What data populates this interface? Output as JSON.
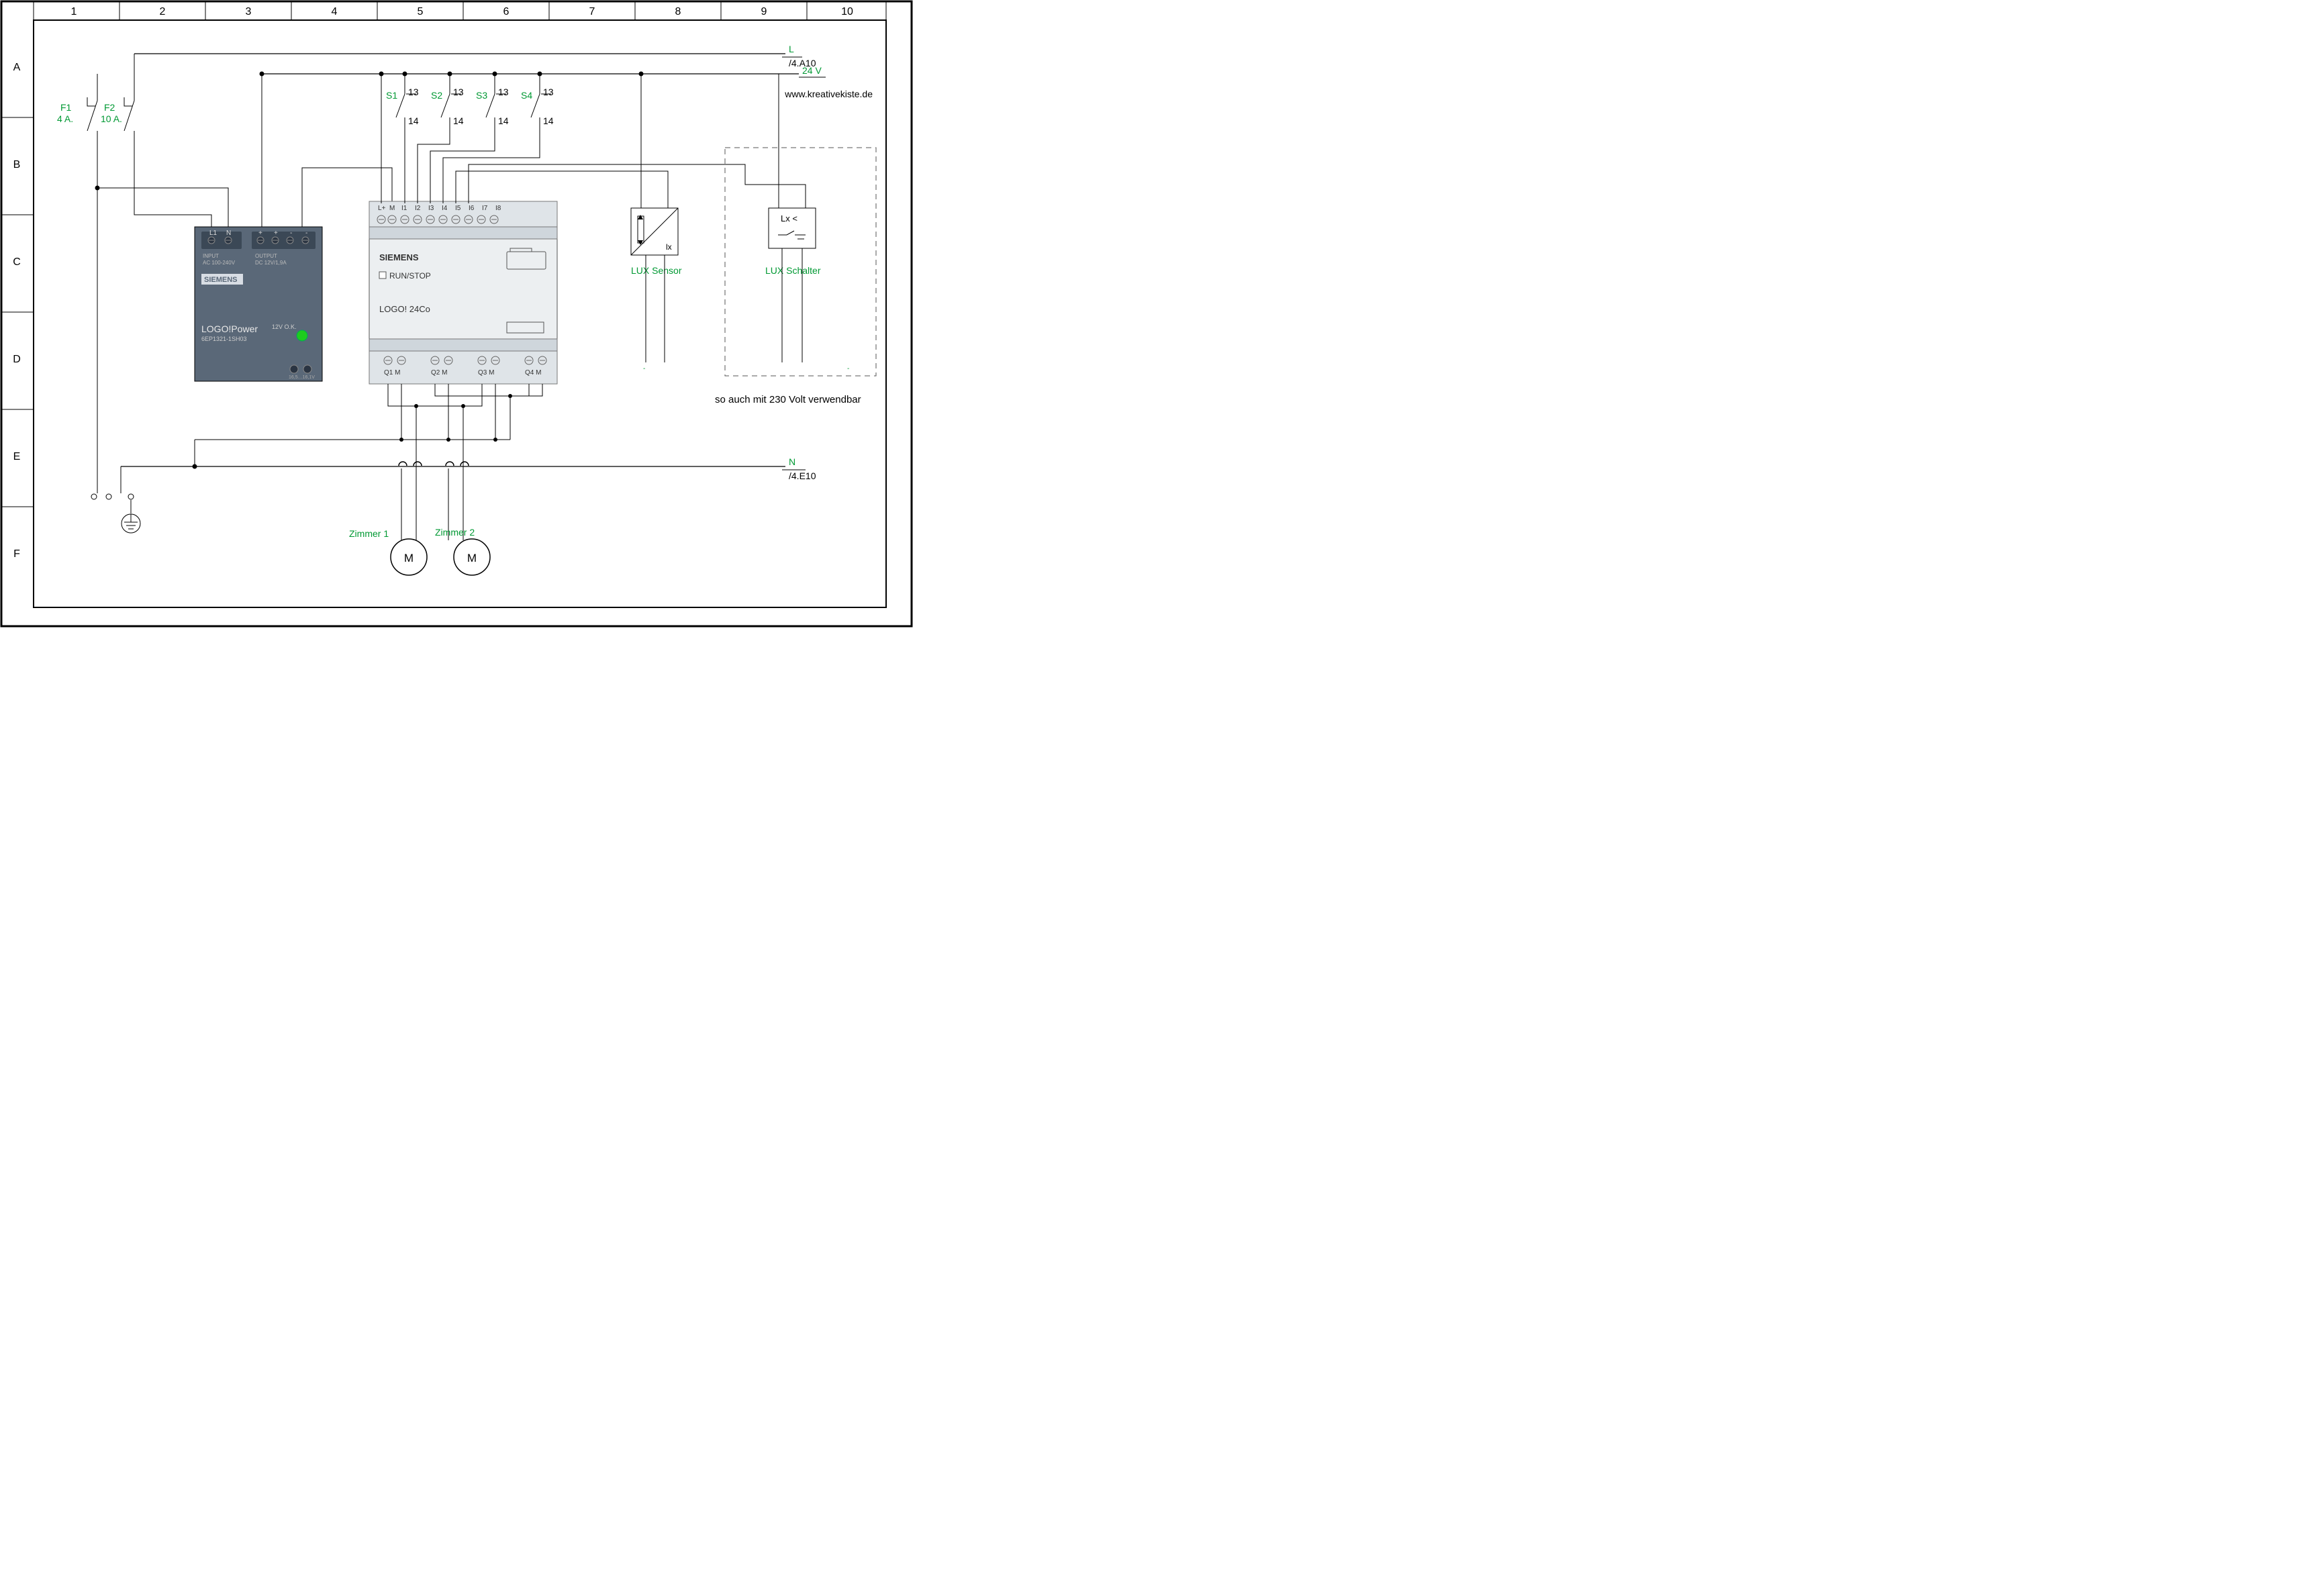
{
  "grid": {
    "cols": [
      "1",
      "2",
      "3",
      "4",
      "5",
      "6",
      "7",
      "8",
      "9",
      "10"
    ],
    "rows": [
      "A",
      "B",
      "C",
      "D",
      "E",
      "F"
    ]
  },
  "url": "www.kreativekiste.de",
  "line_L": {
    "label": "L",
    "ref": "/4.A10"
  },
  "line_24V": {
    "label": "24 V"
  },
  "line_N": {
    "label": "N",
    "ref": "/4.E10"
  },
  "fuses": {
    "F1": {
      "name": "F1",
      "rating": "4 A."
    },
    "F2": {
      "name": "F2",
      "rating": "10 A."
    }
  },
  "switches": [
    {
      "name": "S1",
      "top": "13",
      "bot": "14"
    },
    {
      "name": "S2",
      "top": "13",
      "bot": "14"
    },
    {
      "name": "S3",
      "top": "13",
      "bot": "14"
    },
    {
      "name": "S4",
      "top": "13",
      "bot": "14"
    }
  ],
  "psu": {
    "brand": "SIEMENS",
    "title": "LOGO!Power",
    "model": "6EP1321-1SH03",
    "led_label": "12V O.K.",
    "in_label": "INPUT",
    "in_val": "AC 100-240V",
    "out_label": "OUTPUT",
    "out_val": "DC 12V/1,9A",
    "terms_in": [
      "L1",
      "N"
    ],
    "terms_out": [
      "+",
      "+",
      "-",
      "-"
    ],
    "bottom": "16,5…16,1V"
  },
  "logo": {
    "brand": "SIEMENS",
    "runstop": "RUN/STOP",
    "model": "LOGO! 24Co",
    "inputs": [
      "L+",
      "M",
      "I1",
      "I2",
      "I3",
      "I4",
      "I5",
      "I6",
      "I7",
      "I8"
    ],
    "outputs": [
      "Q1 M",
      "Q2 M",
      "Q3 M",
      "Q4 M"
    ]
  },
  "lux_sensor": {
    "label": "LUX Sensor",
    "symbol": "lx"
  },
  "lux_schalter": {
    "label": "LUX Schalter",
    "symbol": "Lx <"
  },
  "alt_note": "so auch mit 230 Volt verwendbar",
  "motors": {
    "M1": {
      "label": "Zimmer 1",
      "sym": "M"
    },
    "M2": {
      "label": "Zimmer 2",
      "sym": "M"
    }
  }
}
